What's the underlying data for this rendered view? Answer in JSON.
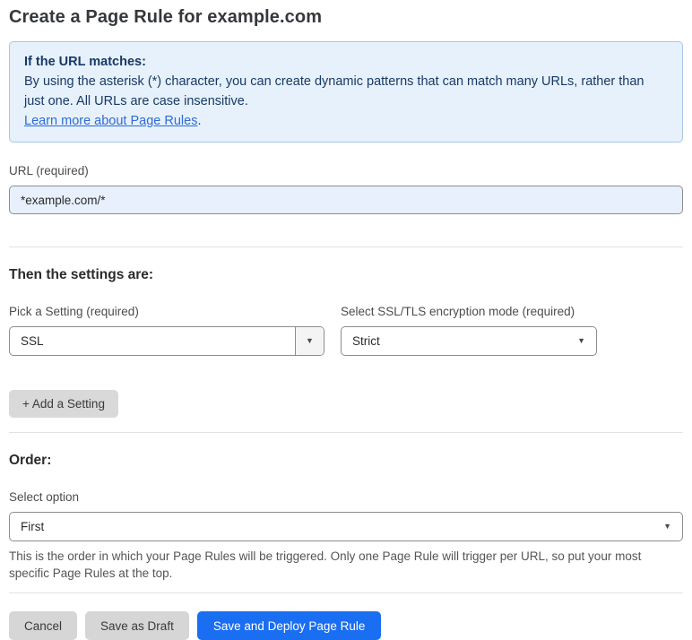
{
  "page": {
    "title": "Create a Page Rule for example.com"
  },
  "info_box": {
    "heading": "If the URL matches:",
    "body": "By using the asterisk (*) character, you can create dynamic patterns that can match many URLs, rather than just one. All URLs are case insensitive.",
    "link_label": "Learn more about Page Rules",
    "link_suffix": "."
  },
  "url_field": {
    "label": "URL (required)",
    "value": "*example.com/*"
  },
  "settings": {
    "heading": "Then the settings are:",
    "setting_picker": {
      "label": "Pick a Setting (required)",
      "value": "SSL"
    },
    "mode_picker": {
      "label": "Select SSL/TLS encryption mode (required)",
      "value": "Strict"
    },
    "add_button_label": "+ Add a Setting"
  },
  "order": {
    "heading": "Order:",
    "select_label": "Select option",
    "select_value": "First",
    "help_text": "This is the order in which your Page Rules will be triggered. Only one Page Rule will trigger per URL, so put your most specific Page Rules at the top."
  },
  "footer": {
    "cancel_label": "Cancel",
    "save_draft_label": "Save as Draft",
    "save_deploy_label": "Save and Deploy Page Rule"
  },
  "icons": {
    "dropdown_arrow": "▼"
  },
  "colors": {
    "primary_button_blue": "#1a6ef2",
    "info_box_background": "#e7f1fb",
    "info_box_border": "#a9c6e4",
    "info_box_text": "#173a66",
    "link_blue": "#2e6bd4",
    "input_highlight_background": "#e8f0fe",
    "secondary_button_gray": "#d6d6d6"
  }
}
